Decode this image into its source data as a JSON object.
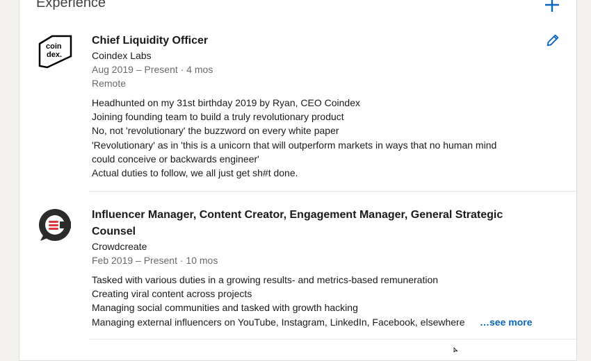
{
  "section": {
    "title": "Experience"
  },
  "entries": [
    {
      "role": "Chief Liquidity Officer",
      "company": "Coindex Labs",
      "dates": "Aug 2019 – Present · 4 mos",
      "location": "Remote",
      "logo_text_1": "coin",
      "logo_text_2": "dex.",
      "description": [
        "Headhunted on my 31st birthday 2019 by Ryan, CEO Coindex",
        "Joining founding team to build a truly revolutionary product",
        "No, not 'revolutionary' the buzzword on every white paper",
        "'Revolutionary' as in 'this is a unicorn that will outperform markets in ways that no human mind",
        "could conceive or backwards engineer'",
        "Actual duties to follow, we all just get sh#t done."
      ]
    },
    {
      "role": "Influencer Manager, Content Creator, Engagement Manager, General Strategic Counsel",
      "company": "Crowdcreate",
      "dates": "Feb 2019 – Present · 10 mos",
      "description": [
        "Tasked with various duties in a growing results- and metrics-based remuneration",
        "Creating viral content across projects",
        "Managing social communities and tasked with growth hacking",
        "Managing external influencers on YouTube, Instagram, LinkedIn, Facebook, elsewhere"
      ],
      "see_more": "…see more"
    }
  ],
  "colors": {
    "accent": "#0a66c2",
    "crowdcreate_red": "#e0353c"
  },
  "icons": {
    "add": "plus-icon",
    "edit": "pencil-icon"
  }
}
